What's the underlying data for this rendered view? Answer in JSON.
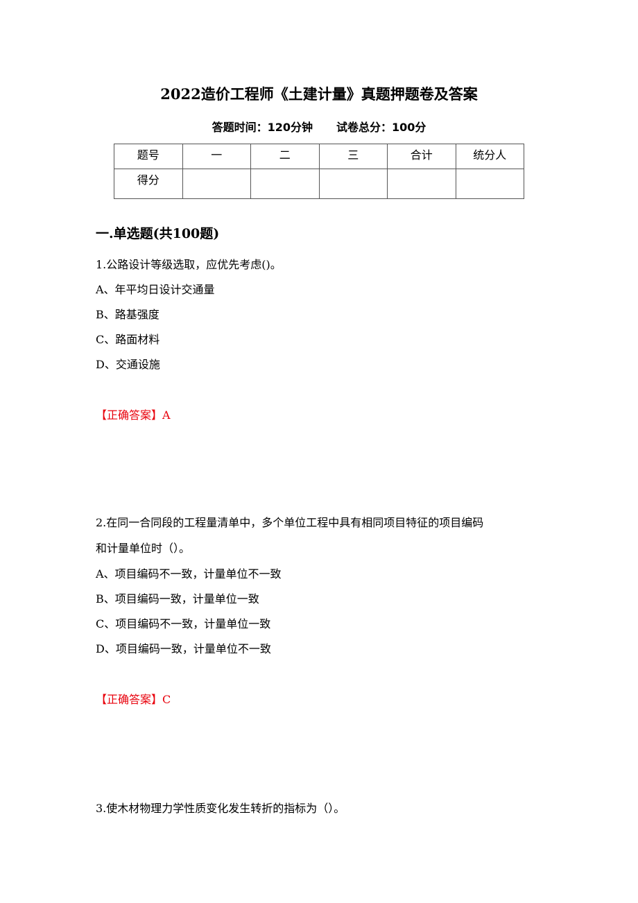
{
  "document": {
    "title": "2022造价工程师《土建计量》真题押题卷及答案",
    "exam_time": "答题时间：120分钟",
    "total_score": "试卷总分：100分"
  },
  "score_table": {
    "header": [
      "题号",
      "一",
      "二",
      "三",
      "合计",
      "统分人"
    ],
    "row": [
      "得分",
      "",
      "",
      "",
      "",
      ""
    ]
  },
  "section": {
    "title": "一.单选题(共100题)"
  },
  "questions": [
    {
      "stem": "1.公路设计等级选取，应优先考虑()。",
      "options": [
        "A、年平均日设计交通量",
        "B、路基强度",
        "C、路面材料",
        "D、交通设施"
      ],
      "answer": "【正确答案】A"
    },
    {
      "stem_line1": "2.在同一合同段的工程量清单中，多个单位工程中具有相同项目特征的项目编码",
      "stem_line2": "和计量单位时（）。",
      "options": [
        "A、项目编码不一致，计量单位不一致",
        "B、项目编码一致，计量单位一致",
        "C、项目编码不一致，计量单位一致",
        "D、项目编码一致，计量单位不一致"
      ],
      "answer": "【正确答案】C"
    },
    {
      "stem": "3.使木材物理力学性质变化发生转折的指标为（）。"
    }
  ],
  "colors": {
    "answer": "#e8000b"
  }
}
